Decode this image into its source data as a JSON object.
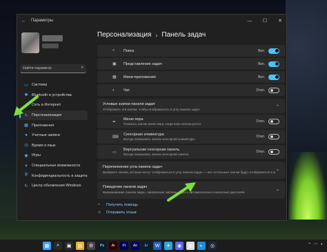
{
  "window": {
    "title": "Параметры",
    "back_icon": "back-arrow-icon",
    "controls": {
      "minimize": "—",
      "maximize": "☐",
      "close": "✕"
    }
  },
  "search": {
    "placeholder": "Найти параметр",
    "icon": "search-icon"
  },
  "sidebar": {
    "items": [
      {
        "label": "Система",
        "icon": "system-icon",
        "glyph": "▭"
      },
      {
        "label": "Bluetooth и устройства",
        "icon": "bluetooth-icon",
        "glyph": "✱"
      },
      {
        "label": "Сеть и Интернет",
        "icon": "network-icon",
        "glyph": "◈"
      },
      {
        "label": "Персонализация",
        "icon": "personalization-brush-icon",
        "glyph": "✎"
      },
      {
        "label": "Приложения",
        "icon": "apps-icon",
        "glyph": "▦"
      },
      {
        "label": "Учетные записи",
        "icon": "accounts-icon",
        "glyph": "●"
      },
      {
        "label": "Время и язык",
        "icon": "time-language-icon",
        "glyph": "◷"
      },
      {
        "label": "Игры",
        "icon": "games-icon",
        "glyph": "◉"
      },
      {
        "label": "Специальные возможности",
        "icon": "accessibility-icon",
        "glyph": "✦"
      },
      {
        "label": "Конфиденциальность и защита",
        "icon": "privacy-shield-icon",
        "glyph": "⛨"
      },
      {
        "label": "Центр обновления Windows",
        "icon": "update-icon",
        "glyph": "↻"
      }
    ]
  },
  "breadcrumb": {
    "parent": "Персонализация",
    "separator": "›",
    "current": "Панель задач"
  },
  "taskbar_items": [
    {
      "label": "Поиск",
      "icon": "search-icon",
      "glyph": "⌕",
      "state": "Вкл.",
      "on": true
    },
    {
      "label": "Представление задач",
      "icon": "task-view-icon",
      "glyph": "▣",
      "state": "Вкл.",
      "on": true
    },
    {
      "label": "Мини-приложения",
      "icon": "widgets-icon",
      "glyph": "▦",
      "state": "Вкл.",
      "on": true
    },
    {
      "label": "Чат",
      "icon": "chat-icon",
      "glyph": "◐",
      "state": "Откл.",
      "on": false
    }
  ],
  "corner_icons_section": {
    "title": "Угловые значки панели задач",
    "description": "Отображать эти значки, чтобы отображалось в углу панели задач"
  },
  "corner_items": [
    {
      "label": "Меню пера",
      "description": "Показать значок меню пера, когда перо используется",
      "icon": "pen-icon",
      "glyph": "✒",
      "state": "Откл.",
      "on": false
    },
    {
      "label": "Сенсорная клавиатура",
      "description": "Всегда показывать значок сенсорной клавиатуры",
      "icon": "keyboard-icon",
      "glyph": "⌨",
      "state": "Откл.",
      "on": false
    },
    {
      "label": "Виртуальная сенсорная панель",
      "description": "Всегда показывать значок сенсорной панели",
      "icon": "touchpad-icon",
      "glyph": "▭",
      "state": "Откл.",
      "on": false
    }
  ],
  "overflow_section": {
    "title": "Переполнение угла панели задач",
    "description": "Выберите значки, которые могут отображаться в углу панели задач — все остальные значки будут отображаться в меню"
  },
  "behavior_section": {
    "title": "Поведение панели задач",
    "description": "Выравнивание панели задач, присвоение эмблем, скрыть автоматически и несколько дисплеев"
  },
  "links": [
    {
      "label": "Получить помощь",
      "icon": "help-icon",
      "glyph": "◔"
    },
    {
      "label": "Отправить отзыв",
      "icon": "feedback-icon",
      "glyph": "☺"
    }
  ],
  "taskbar": {
    "icons": [
      "windows-start-icon",
      "search-icon",
      "task-view-icon",
      "file-explorer-icon",
      "settings-icon",
      "photoshop-icon",
      "illustrator-icon",
      "premiere-icon",
      "after-effects-icon",
      "lightroom-icon",
      "word-icon",
      "telegram-icon",
      "discord-icon",
      "chrome-icon",
      "edge-icon",
      "steam-icon"
    ],
    "tray": [
      "chevron-up-icon",
      "wifi-icon",
      "volume-icon"
    ]
  },
  "colors": {
    "accent": "#4cc2ff",
    "arrow": "#7fe03a",
    "window_bg": "#202020",
    "card_bg": "#2b2b2b"
  }
}
